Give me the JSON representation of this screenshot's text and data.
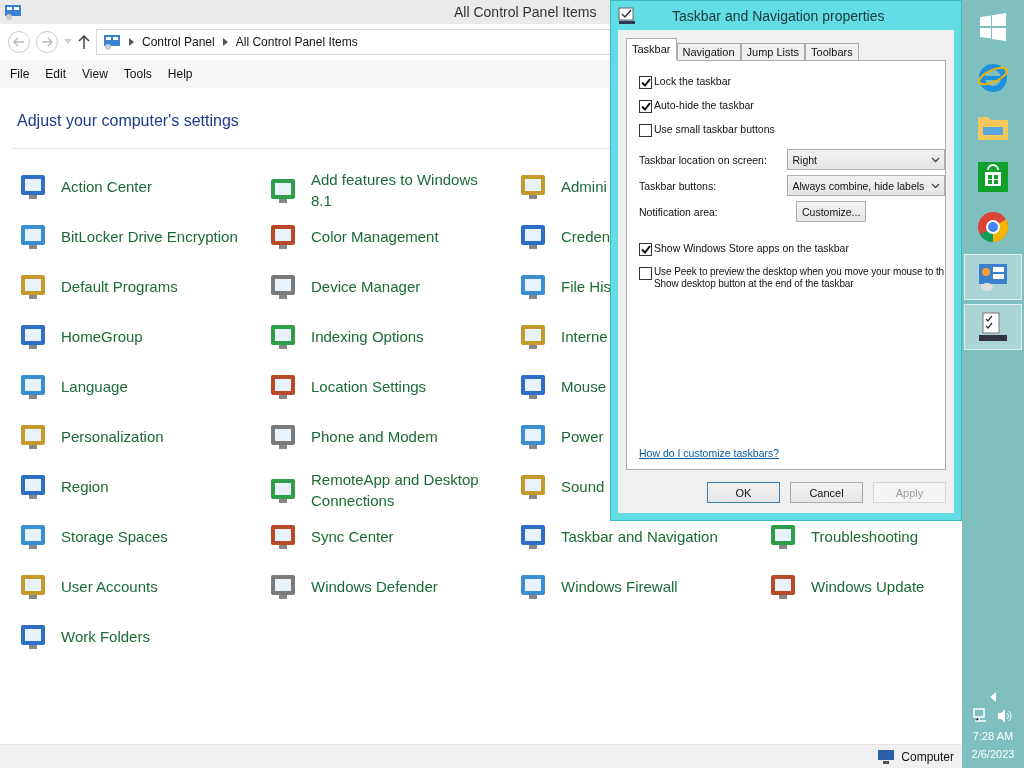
{
  "window": {
    "title": "All Control Panel Items"
  },
  "address": {
    "crumbs": [
      "Control Panel",
      "All Control Panel Items"
    ]
  },
  "menu": [
    "File",
    "Edit",
    "View",
    "Tools",
    "Help"
  ],
  "heading": "Adjust your computer's settings",
  "item_rows": [
    [
      {
        "label": "Action Center"
      },
      {
        "label": "Add features to Windows 8.1"
      },
      {
        "label": "Admini"
      }
    ],
    [
      {
        "label": "BitLocker Drive Encryption"
      },
      {
        "label": "Color Management"
      },
      {
        "label": "Creden"
      }
    ],
    [
      {
        "label": "Default Programs"
      },
      {
        "label": "Device Manager"
      },
      {
        "label": "File His"
      }
    ],
    [
      {
        "label": "HomeGroup"
      },
      {
        "label": "Indexing Options"
      },
      {
        "label": "Interne"
      }
    ],
    [
      {
        "label": "Language"
      },
      {
        "label": "Location Settings"
      },
      {
        "label": "Mouse"
      }
    ],
    [
      {
        "label": "Personalization"
      },
      {
        "label": "Phone and Modem"
      },
      {
        "label": "Power"
      }
    ],
    [
      {
        "label": "Region"
      },
      {
        "label": "RemoteApp and Desktop Connections"
      },
      {
        "label": "Sound"
      }
    ],
    [
      {
        "label": "Storage Spaces"
      },
      {
        "label": "Sync Center"
      },
      {
        "label": "Taskbar and Navigation"
      },
      {
        "label": "Troubleshooting"
      }
    ],
    [
      {
        "label": "User Accounts"
      },
      {
        "label": "Windows Defender"
      },
      {
        "label": "Windows Firewall"
      },
      {
        "label": "Windows Update"
      }
    ],
    [
      {
        "label": "Work Folders"
      }
    ]
  ],
  "status_bar": {
    "text": "Computer"
  },
  "dialog": {
    "title": "Taskbar and Navigation properties",
    "tabs": [
      {
        "label": "Taskbar",
        "selected": true
      },
      {
        "label": "Navigation",
        "selected": false
      },
      {
        "label": "Jump Lists",
        "selected": false
      },
      {
        "label": "Toolbars",
        "selected": false
      }
    ],
    "options": [
      {
        "kind": "checkbox",
        "label": "Lock the taskbar",
        "checked": true
      },
      {
        "kind": "checkbox",
        "label": "Auto-hide the taskbar",
        "checked": true
      },
      {
        "kind": "checkbox",
        "label": "Use small taskbar buttons",
        "checked": false
      },
      {
        "kind": "select",
        "label": "Taskbar location on screen:",
        "value": "Right"
      },
      {
        "kind": "select",
        "label": "Taskbar buttons:",
        "value": "Always combine, hide labels"
      },
      {
        "kind": "button",
        "label": "Notification area:",
        "value": "Customize..."
      },
      {
        "kind": "checkbox",
        "label": "Show Windows Store apps on the taskbar",
        "checked": true
      },
      {
        "kind": "checkbox",
        "label": "Use Peek to preview the desktop when you move your mouse to th",
        "label2": "Show desktop button at the end of the taskbar",
        "checked": false
      }
    ],
    "help_link": "How do I customize taskbars?",
    "buttons": [
      {
        "label": "OK",
        "disabled": false
      },
      {
        "label": "Cancel",
        "disabled": false
      },
      {
        "label": "Apply",
        "disabled": true
      }
    ]
  },
  "tray": {
    "time": "7:28 AM",
    "date": "2/6/2023"
  }
}
